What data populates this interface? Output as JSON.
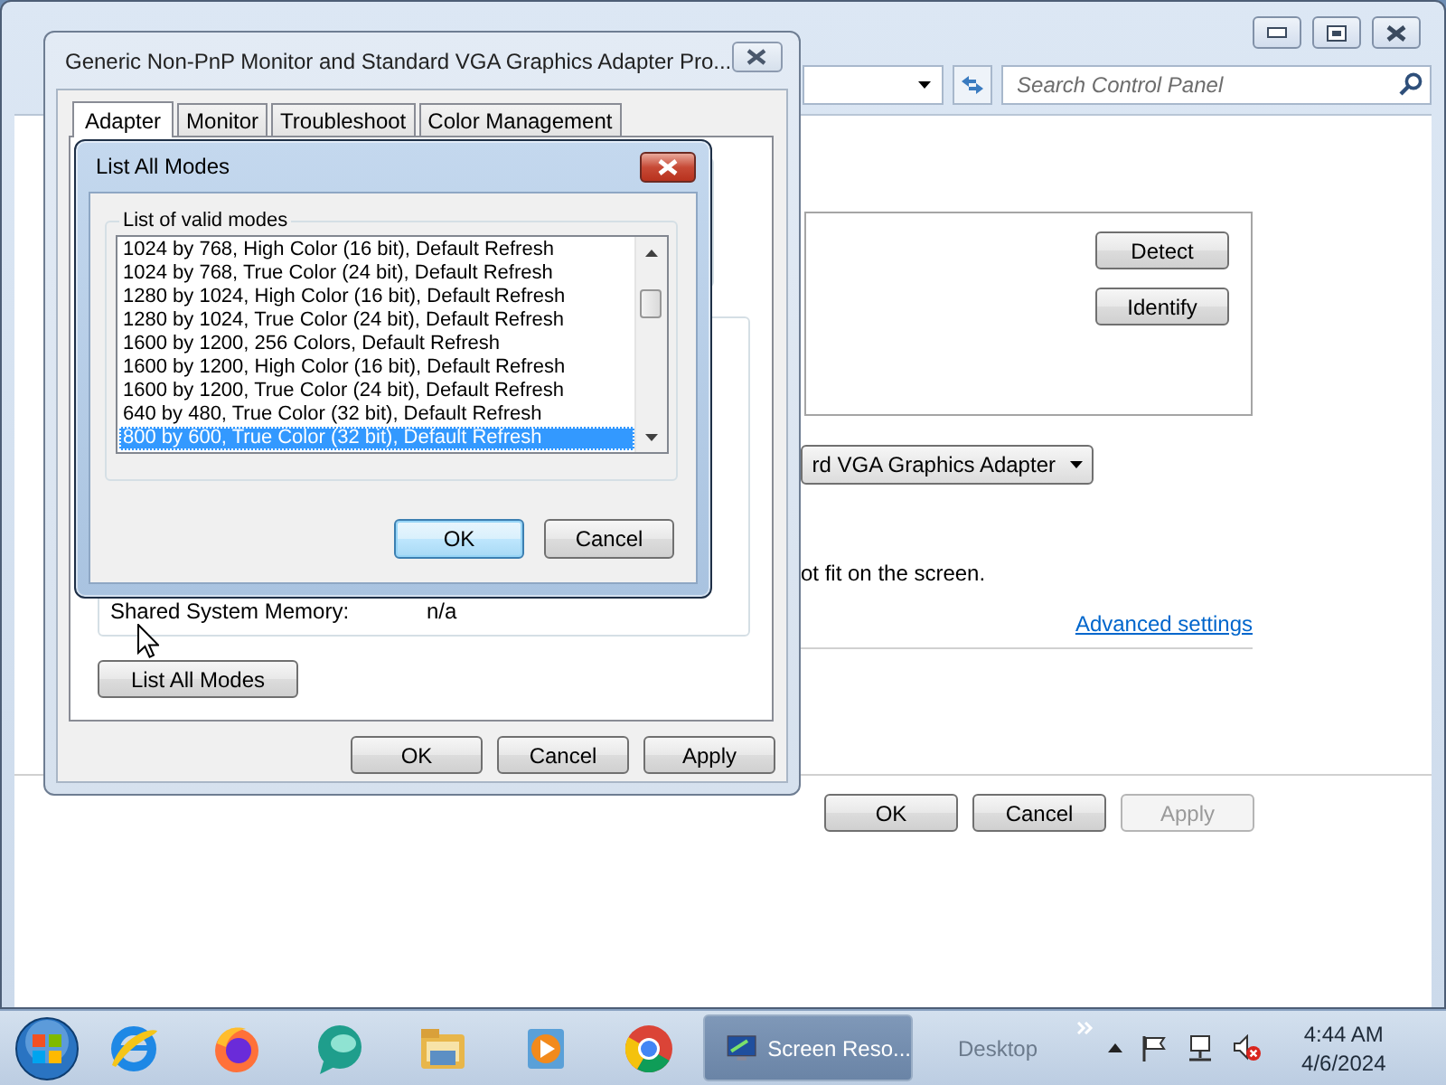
{
  "control_panel_window": {
    "search": {
      "placeholder": "Search Control Panel"
    },
    "side_buttons": [
      "Detect",
      "Identify"
    ],
    "display_dropdown": "rd VGA Graphics Adapter",
    "note": "ot fit on the screen.",
    "link": "Advanced settings",
    "buttons": [
      {
        "label": "OK",
        "disabled": false
      },
      {
        "label": "Cancel",
        "disabled": false
      },
      {
        "label": "Apply",
        "disabled": true
      }
    ]
  },
  "properties_dialog": {
    "title": "Generic Non-PnP Monitor and Standard VGA Graphics Adapter Pro...",
    "tabs": [
      {
        "label": "Adapter",
        "selected": true
      },
      {
        "label": "Monitor",
        "selected": false
      },
      {
        "label": "Troubleshoot",
        "selected": false
      },
      {
        "label": "Color Management",
        "selected": false
      }
    ],
    "info": [
      {
        "label": "Shared System Memory:",
        "value": "n/a"
      }
    ],
    "list_button": "List All Modes",
    "buttons": [
      "OK",
      "Cancel",
      "Apply"
    ]
  },
  "modes_dialog": {
    "title": "List All Modes",
    "group_label": "List of valid modes",
    "modes": [
      {
        "label": "1024 by 768, High Color (16 bit), Default Refresh",
        "selected": false
      },
      {
        "label": "1024 by 768, True Color (24 bit), Default Refresh",
        "selected": false
      },
      {
        "label": "1280 by 1024, High Color (16 bit), Default Refresh",
        "selected": false
      },
      {
        "label": "1280 by 1024, True Color (24 bit), Default Refresh",
        "selected": false
      },
      {
        "label": "1600 by 1200, 256 Colors, Default Refresh",
        "selected": false
      },
      {
        "label": "1600 by 1200, High Color (16 bit), Default Refresh",
        "selected": false
      },
      {
        "label": "1600 by 1200, True Color (24 bit), Default Refresh",
        "selected": false
      },
      {
        "label": "640 by 480, True Color (32 bit), Default Refresh",
        "selected": false
      },
      {
        "label": "800 by 600, True Color (32 bit), Default Refresh",
        "selected": true
      }
    ],
    "buttons": [
      {
        "label": "OK",
        "default": true
      },
      {
        "label": "Cancel",
        "default": false
      }
    ]
  },
  "taskbar": {
    "active_task": "Screen Reso...",
    "desktop": "Desktop",
    "time": "4:44 AM",
    "date": "4/6/2024"
  }
}
